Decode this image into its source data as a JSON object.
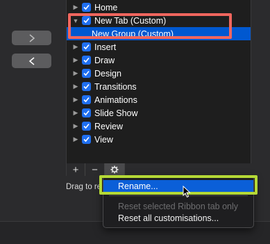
{
  "nav": {
    "forward_icon": "chevron-right-icon",
    "back_icon": "chevron-left-icon"
  },
  "tree": {
    "items": [
      {
        "label": "Home",
        "disclosure": "▶",
        "checked": true,
        "selected": false
      },
      {
        "label": "New Tab (Custom)",
        "disclosure": "▼",
        "checked": true,
        "selected": false
      },
      {
        "label": "New Group (Custom)",
        "disclosure": "",
        "checked": false,
        "selected": true
      },
      {
        "label": "Insert",
        "disclosure": "▶",
        "checked": true,
        "selected": false
      },
      {
        "label": "Draw",
        "disclosure": "▶",
        "checked": true,
        "selected": false
      },
      {
        "label": "Design",
        "disclosure": "▶",
        "checked": true,
        "selected": false
      },
      {
        "label": "Transitions",
        "disclosure": "▶",
        "checked": true,
        "selected": false
      },
      {
        "label": "Animations",
        "disclosure": "▶",
        "checked": true,
        "selected": false
      },
      {
        "label": "Slide Show",
        "disclosure": "▶",
        "checked": true,
        "selected": false
      },
      {
        "label": "Review",
        "disclosure": "▶",
        "checked": true,
        "selected": false
      },
      {
        "label": "View",
        "disclosure": "▶",
        "checked": true,
        "selected": false
      }
    ]
  },
  "toolbar": {
    "add_label": "+",
    "remove_label": "−",
    "settings_icon": "gear-icon"
  },
  "drag_text": "Drag to re",
  "context_menu": {
    "items": [
      {
        "label": "Rename...",
        "state": "active"
      },
      {
        "label": "Reset selected Ribbon tab only",
        "state": "disabled"
      },
      {
        "label": "Reset all customisations...",
        "state": "normal"
      }
    ]
  },
  "colors": {
    "accent": "#0058d0",
    "highlight_red": "#f0665e",
    "highlight_green": "#b5d936"
  }
}
